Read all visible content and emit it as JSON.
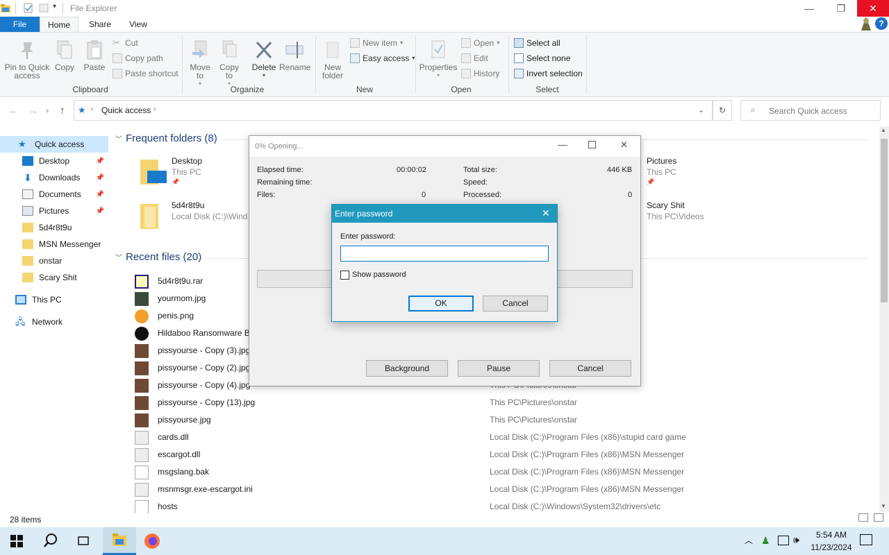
{
  "window": {
    "title": "File Explorer",
    "minimize": "—",
    "maximize": "❐",
    "close": "✕",
    "help": "?"
  },
  "ribbon_tabs": [
    "File",
    "Home",
    "Share",
    "View"
  ],
  "ribbon": {
    "clipboard": {
      "pin": "Pin to Quick access",
      "copy": "Copy",
      "paste": "Paste",
      "cut": "Cut",
      "copy_path": "Copy path",
      "paste_shortcut": "Paste shortcut",
      "label": "Clipboard"
    },
    "organize": {
      "move_to": "Move to",
      "copy_to": "Copy to",
      "delete": "Delete",
      "rename": "Rename",
      "label": "Organize"
    },
    "new": {
      "new_folder": "New folder",
      "new_item": "New item",
      "easy_access": "Easy access",
      "label": "New"
    },
    "open": {
      "properties": "Properties",
      "open": "Open",
      "edit": "Edit",
      "history": "History",
      "label": "Open"
    },
    "select": {
      "select_all": "Select all",
      "select_none": "Select none",
      "invert": "Invert selection",
      "label": "Select"
    }
  },
  "address": {
    "path": "Quick access",
    "search_placeholder": "Search Quick access"
  },
  "nav": {
    "quick_access": "Quick access",
    "items": [
      "Desktop",
      "Downloads",
      "Documents",
      "Pictures",
      "5d4r8t9u",
      "MSN Messenger",
      "onstar",
      "Scary Shit"
    ],
    "this_pc": "This PC",
    "network": "Network"
  },
  "frequent": {
    "header": "Frequent folders (8)",
    "tiles": [
      {
        "name": "Desktop",
        "sub": "This PC"
      },
      {
        "name": "5d4r8t9u",
        "sub": "Local Disk (C:)\\Windo"
      },
      {
        "name": "Pictures",
        "sub": "This PC"
      },
      {
        "name": "Scary Shit",
        "sub": "This PC\\Videos"
      }
    ]
  },
  "recent": {
    "header": "Recent files (20)",
    "files": [
      {
        "name": "5d4r8t9u.rar",
        "path": ""
      },
      {
        "name": "yourmom.jpg",
        "path": ""
      },
      {
        "name": "penis.png",
        "path": ""
      },
      {
        "name": "Hildaboo Ransomware B",
        "path": ""
      },
      {
        "name": "pissyourse - Copy (3).jpg",
        "path": ""
      },
      {
        "name": "pissyourse - Copy (2).jpg",
        "path": ""
      },
      {
        "name": "pissyourse - Copy (4).jpg",
        "path": "This PC\\Pictures\\onstar"
      },
      {
        "name": "pissyourse - Copy (13).jpg",
        "path": "This PC\\Pictures\\onstar"
      },
      {
        "name": "pissyourse.jpg",
        "path": "This PC\\Pictures\\onstar"
      },
      {
        "name": "cards.dll",
        "path": "Local Disk (C:)\\Program Files (x86)\\stupid card game"
      },
      {
        "name": "escargot.dll",
        "path": "Local Disk (C:)\\Program Files (x86)\\MSN Messenger"
      },
      {
        "name": "msgslang.bak",
        "path": "Local Disk (C:)\\Program Files (x86)\\MSN Messenger"
      },
      {
        "name": "msnmsgr.exe-escargot.ini",
        "path": "Local Disk (C:)\\Program Files (x86)\\MSN Messenger"
      },
      {
        "name": "hosts",
        "path": "Local Disk (C:)\\Windows\\System32\\drivers\\etc"
      }
    ]
  },
  "status": {
    "items": "28 items"
  },
  "progress_dialog": {
    "title": "0% Opening...",
    "elapsed_label": "Elapsed time:",
    "elapsed_value": "00:00:02",
    "remaining_label": "Remaining time:",
    "files_label": "Files:",
    "files_value": "0",
    "total_size_label": "Total size:",
    "total_size_value": "446 KB",
    "speed_label": "Speed:",
    "processed_label": "Processed:",
    "processed_value": "0",
    "progress": 0,
    "background": "Background",
    "pause": "Pause",
    "cancel": "Cancel"
  },
  "password_dialog": {
    "title": "Enter password",
    "label": "Enter password:",
    "value": "",
    "show_password": "Show password",
    "ok": "OK",
    "cancel": "Cancel"
  },
  "taskbar": {
    "time": "5:54 AM",
    "date": "11/23/2024"
  },
  "colors": {
    "accent": "#1979ca",
    "dialog_header": "#2199bd",
    "close_red": "#e81123",
    "section_header": "#1e3d7b"
  }
}
